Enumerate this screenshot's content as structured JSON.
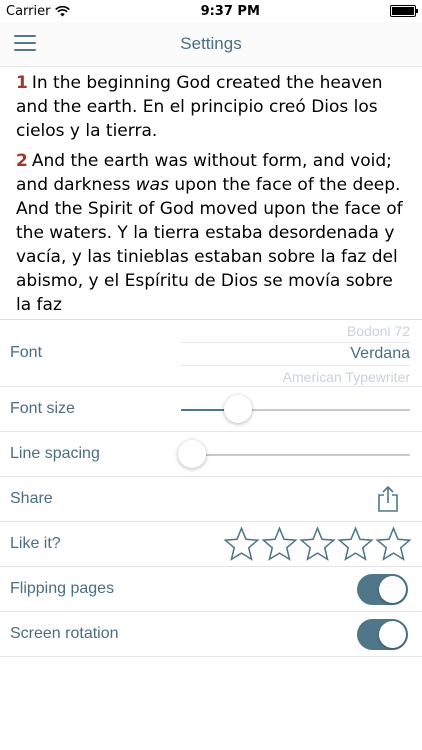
{
  "status_bar": {
    "carrier": "Carrier",
    "time": "9:37 PM"
  },
  "navbar": {
    "title": "Settings"
  },
  "reader": {
    "verses": [
      {
        "number": "1",
        "text": "In the beginning God created the heaven and the earth.  En el principio creó Dios los cielos y la tierra."
      },
      {
        "number": "2",
        "text_before": "And the earth was without form, and void; and darkness ",
        "text_italic": "was",
        "text_after": " upon the face of the deep. And the Spirit of God moved upon the face of the waters.  Y la tierra estaba desordenada y vacía, y las tinieblas estaban sobre la faz del abismo, y el Espíritu de Dios se movía sobre la faz"
      }
    ]
  },
  "settings": {
    "font": {
      "label": "Font",
      "options": [
        "Bodoni 72",
        "Verdana",
        "American Typewriter"
      ],
      "selected": "Verdana"
    },
    "font_size": {
      "label": "Font size",
      "value": 0.25
    },
    "line_spacing": {
      "label": "Line spacing",
      "value": 0.05
    },
    "share": {
      "label": "Share",
      "icon": "share-icon"
    },
    "like": {
      "label": "Like it?",
      "stars_total": 5,
      "stars_filled": 0
    },
    "flipping_pages": {
      "label": "Flipping pages",
      "on": true
    },
    "screen_rotation": {
      "label": "Screen rotation",
      "on": true
    }
  },
  "colors": {
    "accent": "#4f7789",
    "verse_number": "#a4362b",
    "label": "#4a6e82"
  }
}
